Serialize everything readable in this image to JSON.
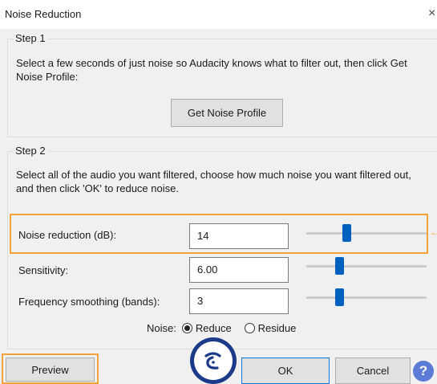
{
  "window": {
    "title": "Noise Reduction",
    "close_glyph": "×"
  },
  "step1": {
    "legend": "Step 1",
    "text": "Select a few seconds of just noise so Audacity knows what to filter out, then click Get Noise Profile:",
    "button_label": "Get Noise Profile"
  },
  "step2": {
    "legend": "Step 2",
    "text": "Select all of the audio you want filtered, choose how much noise you want filtered out, and then click 'OK' to reduce noise."
  },
  "controls": {
    "noise_reduction": {
      "label": "Noise reduction (dB):",
      "value": "14",
      "slider_fraction": 0.33
    },
    "sensitivity": {
      "label": "Sensitivity:",
      "value": "6.00",
      "slider_fraction": 0.27
    },
    "frequency_smoothing": {
      "label": "Frequency smoothing (bands):",
      "value": "3",
      "slider_fraction": 0.27
    }
  },
  "noise_mode": {
    "label": "Noise:",
    "options": [
      {
        "label": "Reduce",
        "selected": true
      },
      {
        "label": "Residue",
        "selected": false
      }
    ]
  },
  "buttons": {
    "preview": "Preview",
    "ok": "OK",
    "cancel": "Cancel",
    "help": "?"
  },
  "colors": {
    "highlight": "#f2a33a",
    "slider_thumb": "#0060c0",
    "default_border": "#0078d7",
    "logo": "#1c3a8a"
  },
  "icons": {
    "help": "help-icon",
    "close": "close-icon",
    "watermark": "logo-icon"
  }
}
